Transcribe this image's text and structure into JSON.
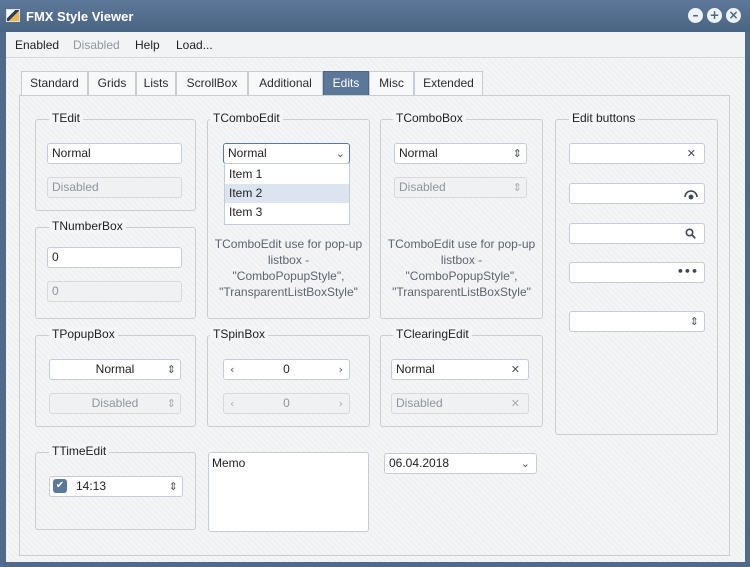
{
  "window": {
    "title": "FMX Style Viewer"
  },
  "menu": {
    "enabled": "Enabled",
    "disabled": "Disabled",
    "help": "Help",
    "load": "Load..."
  },
  "tabs": [
    "Standard",
    "Grids",
    "Lists",
    "ScrollBox",
    "Additional",
    "Edits",
    "Misc",
    "Extended"
  ],
  "active_tab": "Edits",
  "tedit": {
    "title": "TEdit",
    "value": "Normal",
    "disabled_value": "Disabled"
  },
  "tnumberbox": {
    "title": "TNumberBox",
    "value": "0",
    "disabled_value": "0"
  },
  "tpopupbox": {
    "title": "TPopupBox",
    "value": "Normal",
    "disabled_value": "Disabled"
  },
  "ttimeedit": {
    "title": "TTimeEdit",
    "value": "14:13",
    "checked": true
  },
  "tcomboedit": {
    "title": "TComboEdit",
    "value": "Normal",
    "items": [
      "Item 1",
      "Item 2",
      "Item 3"
    ],
    "selected_item": "Item 2",
    "note": [
      "TComboEdit use for pop-up",
      "listbox -",
      "\"ComboPopupStyle\",",
      "\"TransparentListBoxStyle\""
    ]
  },
  "tspinbox": {
    "title": "TSpinBox",
    "value": "0",
    "disabled_value": "0"
  },
  "memo": {
    "text": "Memo"
  },
  "tcombobox": {
    "title": "TComboBox",
    "value": "Normal",
    "disabled_value": "Disabled",
    "note": [
      "TComboEdit use for pop-up",
      "listbox -",
      "\"ComboPopupStyle\",",
      "\"TransparentListBoxStyle\""
    ]
  },
  "tclearingedit": {
    "title": "TClearingEdit",
    "value": "Normal",
    "disabled_value": "Disabled"
  },
  "dateedit": {
    "value": "06.04.2018"
  },
  "edit_buttons": {
    "title": "Edit buttons"
  },
  "colors": {
    "titlebar": "#4f6a8a",
    "accent": "#5b7898",
    "panel": "#f4f5f7"
  },
  "icons": [
    "app-icon",
    "minimize-icon",
    "maximize-icon",
    "close-icon",
    "chevron-down-icon",
    "chevron-updown-icon",
    "chevron-left-icon",
    "chevron-right-icon",
    "clear-x-icon",
    "password-eye-icon",
    "search-icon",
    "ellipsis-icon",
    "check-icon"
  ]
}
